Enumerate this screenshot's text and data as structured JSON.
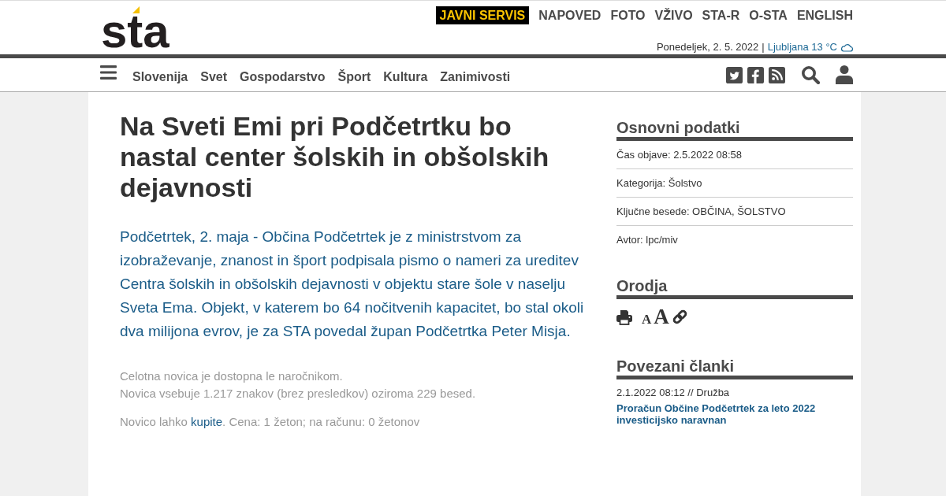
{
  "header": {
    "logo": "sta",
    "top_links": [
      {
        "label": "JAVNI SERVIS",
        "highlighted": true
      },
      {
        "label": "NAPOVED",
        "highlighted": false
      },
      {
        "label": "FOTO",
        "highlighted": false
      },
      {
        "label": "VŽIVO",
        "highlighted": false
      },
      {
        "label": "STA-R",
        "highlighted": false
      },
      {
        "label": "O-STA",
        "highlighted": false
      },
      {
        "label": "ENGLISH",
        "highlighted": false
      }
    ],
    "date": "Ponedeljek, 2. 5. 2022",
    "separator": "|",
    "weather": "Ljubljana 13 °C"
  },
  "nav": {
    "items": [
      "Slovenija",
      "Svet",
      "Gospodarstvo",
      "Šport",
      "Kultura",
      "Zanimivosti"
    ]
  },
  "article": {
    "title": "Na Sveti Emi pri Podčetrtku bo nastal center šolskih in obšolskih dejavnosti",
    "lead": "Podčetrtek, 2. maja - Občina Podčetrtek je z ministrstvom za izobraževanje, znanost in šport podpisala pismo o nameri za ureditev Centra šolskih in obšolskih dejavnosti v objektu stare šole v naselju Sveta Ema. Objekt, v katerem bo 64 nočitvenih kapacitet, bo stal okoli dva milijona evrov, je za STA povedal župan Podčetrtka Peter Misja.",
    "notice": [
      "Celotna novica je dostopna le naročnikom.",
      "Novica vsebuje 1.217 znakov (brez presledkov) oziroma 229 besed."
    ],
    "purchase": {
      "before": "Novico lahko",
      "link": "kupite",
      "after": ". Cena: 1 žeton; na računu: 0 žetonov"
    }
  },
  "sidebar": {
    "basic_info": {
      "title": "Osnovni podatki",
      "rows": [
        "Čas objave: 2.5.2022 08:58",
        "Kategorija: Šolstvo",
        "Ključne besede: OBČINA, ŠOLSTVO",
        "Avtor: lpc/miv"
      ]
    },
    "tools": {
      "title": "Orodja",
      "items": [
        {
          "kind": "print"
        },
        {
          "kind": "font-smaller",
          "label": "A"
        },
        {
          "kind": "font-larger",
          "label": "A"
        },
        {
          "kind": "link"
        }
      ]
    },
    "related": {
      "title": "Povezani članki",
      "items": [
        {
          "meta": "2.1.2022 08:12 // Družba",
          "title": "Proračun Občine Podčetrtek za leto 2022 investicijsko naravnan"
        }
      ]
    }
  }
}
